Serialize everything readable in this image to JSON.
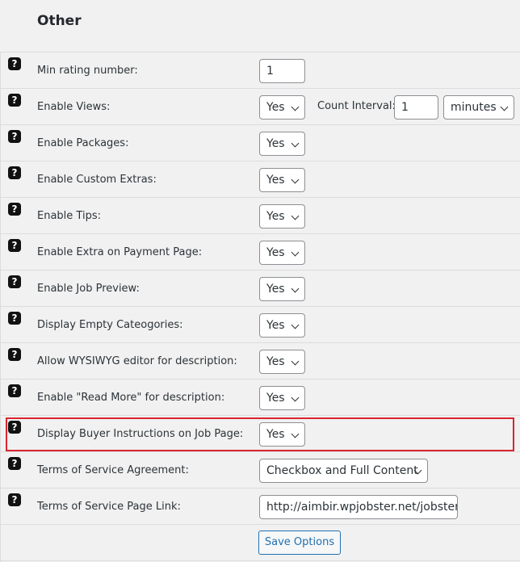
{
  "section": {
    "title": "Other"
  },
  "help_icon_glyph": "?",
  "rows": [
    {
      "label": "Min rating number:",
      "control": "input",
      "value": "1"
    },
    {
      "label": "Enable Views:",
      "control": "select",
      "value": "Yes",
      "extra": {
        "label": "Count Interval:",
        "input_value": "1",
        "unit_value": "minutes"
      }
    },
    {
      "label": "Enable Packages:",
      "control": "select",
      "value": "Yes"
    },
    {
      "label": "Enable Custom Extras:",
      "control": "select",
      "value": "Yes"
    },
    {
      "label": "Enable Tips:",
      "control": "select",
      "value": "Yes"
    },
    {
      "label": "Enable Extra on Payment Page:",
      "control": "select",
      "value": "Yes"
    },
    {
      "label": "Enable Job Preview:",
      "control": "select",
      "value": "Yes"
    },
    {
      "label": "Display Empty Cateogories:",
      "control": "select",
      "value": "Yes"
    },
    {
      "label": "Allow WYSIWYG editor for description:",
      "control": "select",
      "value": "Yes"
    },
    {
      "label": "Enable \"Read More\" for description:",
      "control": "select",
      "value": "Yes"
    },
    {
      "label": "Display Buyer Instructions on Job Page:",
      "control": "select",
      "value": "Yes",
      "highlighted": true
    },
    {
      "label": "Terms of Service Agreement:",
      "control": "select",
      "value": "Checkbox and Full Content"
    },
    {
      "label": "Terms of Service Page Link:",
      "control": "input",
      "value": "http://aimbir.wpjobster.net/jobster"
    }
  ],
  "save_button": {
    "label": "Save Options"
  },
  "colors": {
    "highlight_border": "#d9262f",
    "button_text": "#2271b1",
    "background": "#f1f1f1"
  }
}
